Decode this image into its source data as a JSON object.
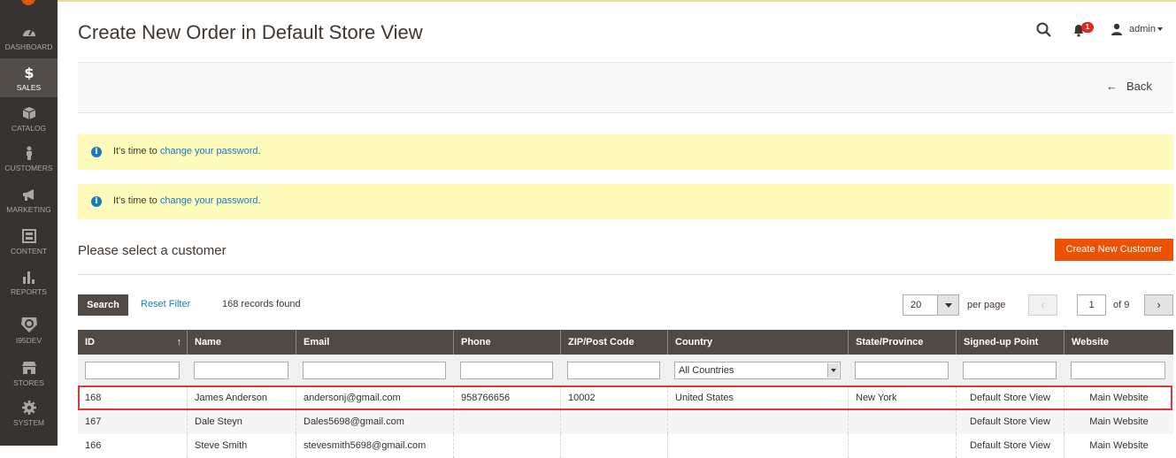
{
  "sidebar": {
    "items": [
      {
        "label": "DASHBOARD",
        "icon": "dashboard-icon"
      },
      {
        "label": "SALES",
        "icon": "dollar-icon",
        "active": true
      },
      {
        "label": "CATALOG",
        "icon": "box-icon"
      },
      {
        "label": "CUSTOMERS",
        "icon": "person-icon"
      },
      {
        "label": "MARKETING",
        "icon": "megaphone-icon"
      },
      {
        "label": "CONTENT",
        "icon": "layout-icon"
      },
      {
        "label": "REPORTS",
        "icon": "bar-chart-icon"
      },
      {
        "label": "I95DEV",
        "icon": "i95dev-icon"
      },
      {
        "label": "STORES",
        "icon": "storefront-icon"
      },
      {
        "label": "SYSTEM",
        "icon": "gear-icon"
      }
    ]
  },
  "header": {
    "title": "Create New Order in Default Store View",
    "notification_count": "1",
    "user": "admin"
  },
  "actions": {
    "back_label": "Back"
  },
  "messages": [
    {
      "prefix": "It's time to ",
      "link": "change your password",
      "suffix": "."
    },
    {
      "prefix": "It's time to ",
      "link": "change your password",
      "suffix": "."
    }
  ],
  "customer_section": {
    "title": "Please select a customer",
    "create_button": "Create New Customer"
  },
  "toolbar": {
    "search_label": "Search",
    "reset_label": "Reset Filter",
    "records_text": "168 records found",
    "per_page_value": "20",
    "per_page_label": "per page",
    "page_value": "1",
    "page_of": "of 9"
  },
  "grid": {
    "columns": [
      "ID",
      "Name",
      "Email",
      "Phone",
      "ZIP/Post Code",
      "Country",
      "State/Province",
      "Signed-up Point",
      "Website"
    ],
    "country_filter": "All Countries",
    "rows": [
      [
        "168",
        "James Anderson",
        "andersonj@gmail.com",
        "958766656",
        "10002",
        "United States",
        "New York",
        "Default Store View",
        "Main Website"
      ],
      [
        "167",
        "Dale Steyn",
        "Dales5698@gmail.com",
        "",
        "",
        "",
        "",
        "Default Store View",
        "Main Website"
      ],
      [
        "166",
        "Steve Smith",
        "stevesmith5698@gmail.com",
        "",
        "",
        "",
        "",
        "Default Store View",
        "Main Website"
      ]
    ]
  },
  "colors": {
    "sidebar_bg": "#373330",
    "accent": "#eb5202",
    "grid_header": "#514943",
    "message_bg": "#fffbbb",
    "link": "#1979c3",
    "highlight": "#d9373b"
  }
}
